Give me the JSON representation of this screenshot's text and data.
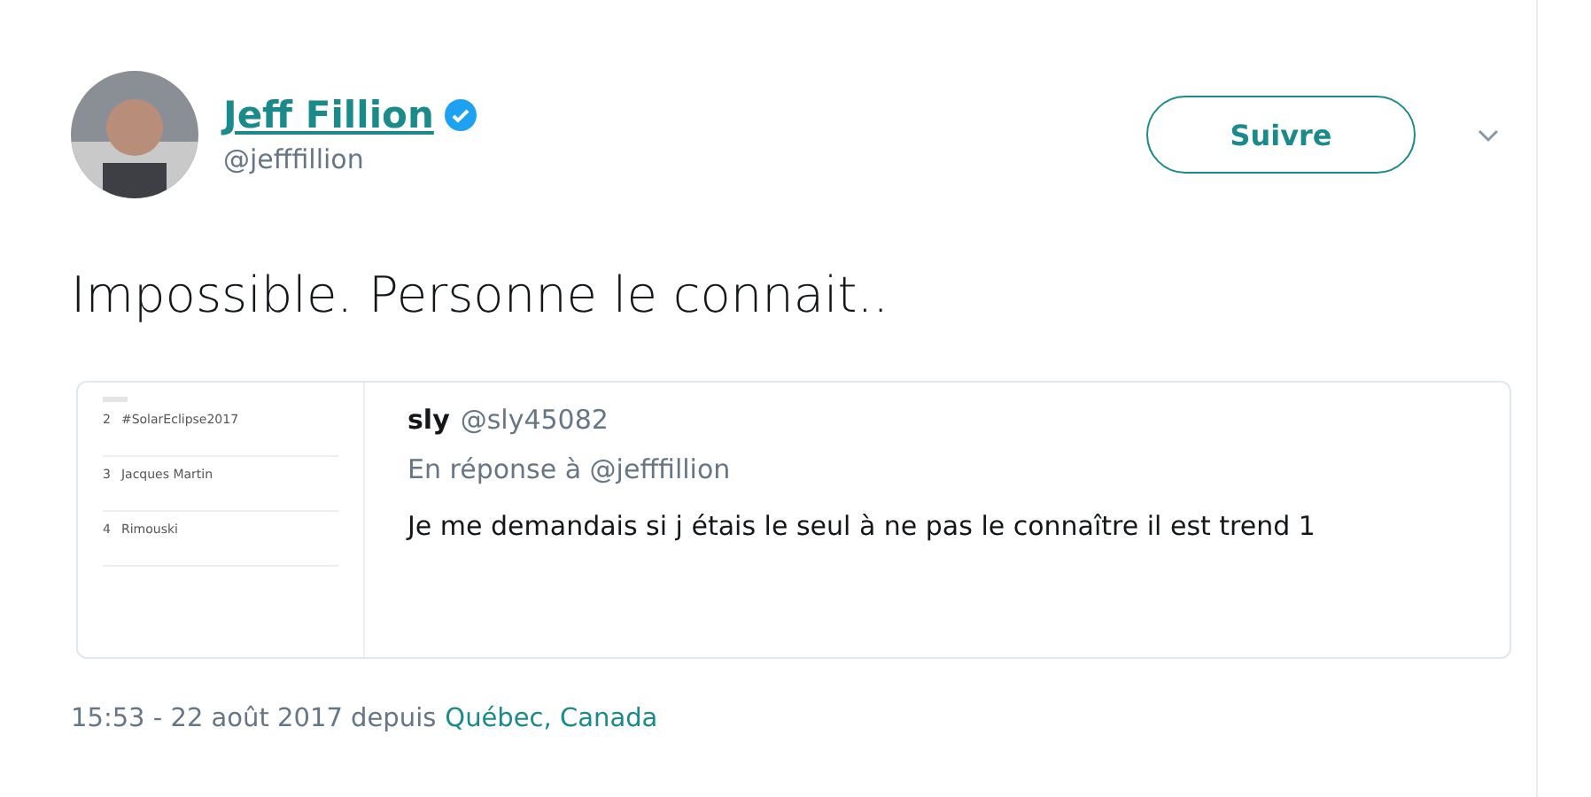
{
  "author": {
    "name": "Jeff Fillion",
    "verified": true,
    "handle": "@jefffillion"
  },
  "follow_button": {
    "label": "Suivre"
  },
  "tweet_text": "Impossible. Personne le connait..",
  "quoted_tweet": {
    "thumbnail": {
      "trends": [
        {
          "rank": "2",
          "label": "#SolarEclipse2017"
        },
        {
          "rank": "3",
          "label": "Jacques Martin"
        },
        {
          "rank": "4",
          "label": "Rimouski"
        }
      ]
    },
    "author_name": "sly",
    "author_handle": "@sly45082",
    "reply_to": "En réponse à @jefffillion",
    "text": "Je me demandais si j étais le seul à ne pas le connaître il est trend 1"
  },
  "footer": {
    "timestamp": "15:53 - 22 août 2017 depuis",
    "location": "Québec, Canada"
  }
}
